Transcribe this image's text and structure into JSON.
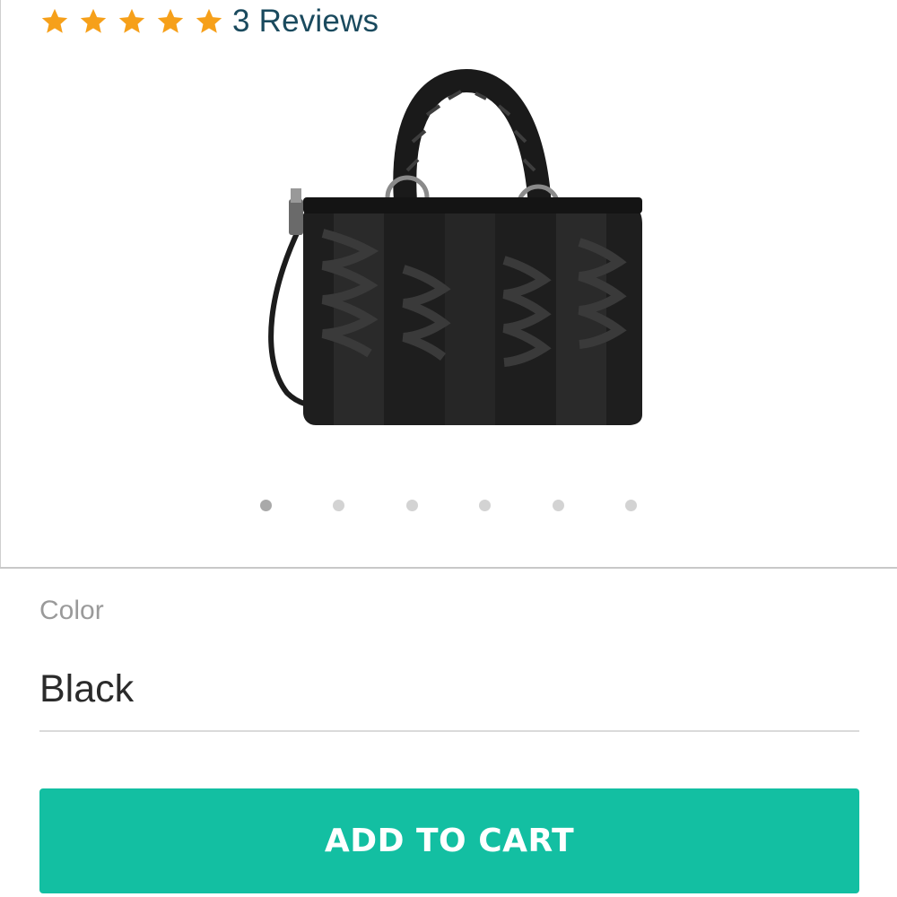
{
  "rating": {
    "stars": 5,
    "max_stars": 5,
    "reviews_text": "3 Reviews",
    "star_color": "#f6a01a"
  },
  "carousel": {
    "image_icon": "handbag-image",
    "total_slides": 6,
    "active_index": 0
  },
  "color": {
    "label": "Color",
    "selected": "Black"
  },
  "cart": {
    "button_label": "ADD TO CART",
    "button_color": "#13bfa2"
  }
}
